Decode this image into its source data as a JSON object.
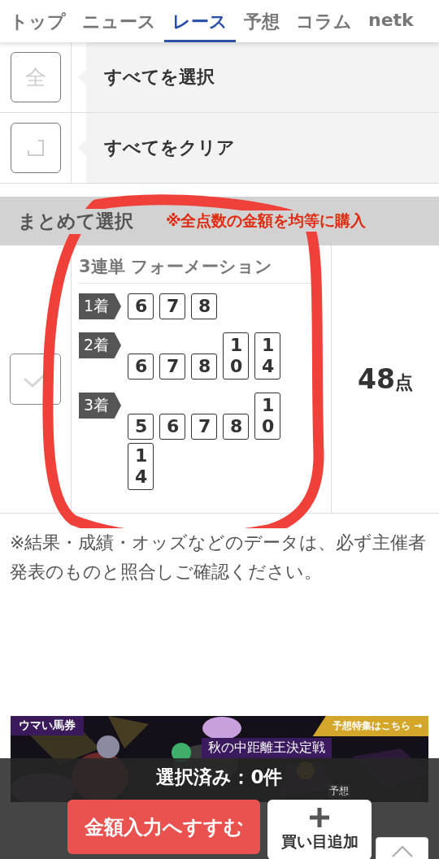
{
  "tabs": [
    {
      "label": "トップ",
      "selected": false
    },
    {
      "label": "ニュース",
      "selected": false
    },
    {
      "label": "レース",
      "selected": true
    },
    {
      "label": "予想",
      "selected": false
    },
    {
      "label": "コラム",
      "selected": false
    },
    {
      "label": "netk",
      "selected": false
    }
  ],
  "actions": [
    {
      "kind": "all",
      "icon_text": "全",
      "label": "すべてを選択"
    },
    {
      "kind": "clear",
      "label": "すべてをクリア"
    }
  ],
  "bulk": {
    "title": "まとめて選択",
    "note": "※全点数の金額を均等に購入",
    "checked": false,
    "bet_type": "3連単 フォーメーション",
    "positions": [
      {
        "label": "1着",
        "numbers": [
          "6",
          "7",
          "8"
        ]
      },
      {
        "label": "2着",
        "numbers": [
          "6",
          "7",
          "8",
          "10",
          "14"
        ]
      },
      {
        "label": "3着",
        "numbers": [
          "5",
          "6",
          "7",
          "8",
          "10",
          "14"
        ]
      }
    ],
    "points": "48",
    "points_unit": "点"
  },
  "disclaimer": "※結果・成績・オッズなどのデータは、必ず主催者発表のものと照合しご確認ください。",
  "banner": {
    "kind": "picture",
    "brand": "ウマい馬券",
    "link": "予想特集はこちら →",
    "headline": "秋の中距離王決定戦",
    "tag": "予想"
  },
  "bottom_bar": {
    "selected_count": "選択済み：0件",
    "primary_button": "金額入力へすすむ",
    "add_button": "買い目追加"
  }
}
